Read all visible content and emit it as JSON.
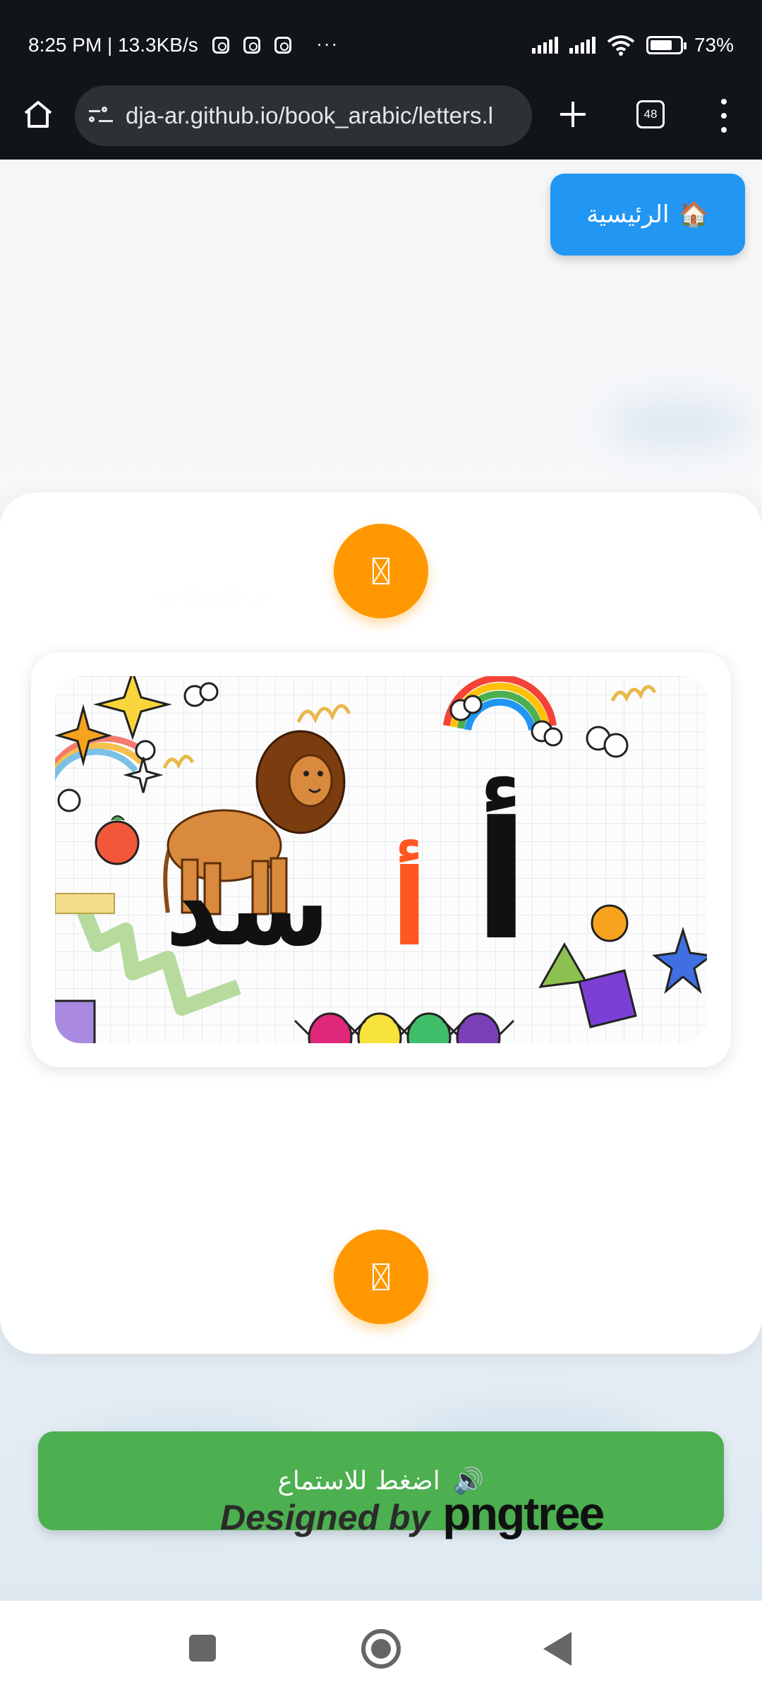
{
  "status_bar": {
    "time_speed": "8:25 PM | 13.3KB/s",
    "more": "···",
    "battery": "73%"
  },
  "browser": {
    "url": "dja-ar.github.io/book_arabic/letters.l",
    "tab_count": "48"
  },
  "page": {
    "home_label": "الرئيسية",
    "home_emoji": "🏠",
    "listen_label": "اضغط للاستماع",
    "listen_emoji": "🔊",
    "card_image": {
      "letter": "أ",
      "word_first_letter": "أ",
      "word_rest": "سد"
    },
    "credit_prefix": "Designed by",
    "credit_brand": "pngtree"
  },
  "colors": {
    "status_bg": "#111419",
    "home_button": "#2196f3",
    "nav_round_buttons": "#ff9800",
    "listen_button": "#4caf50",
    "accent_letter": "#ff5722"
  }
}
